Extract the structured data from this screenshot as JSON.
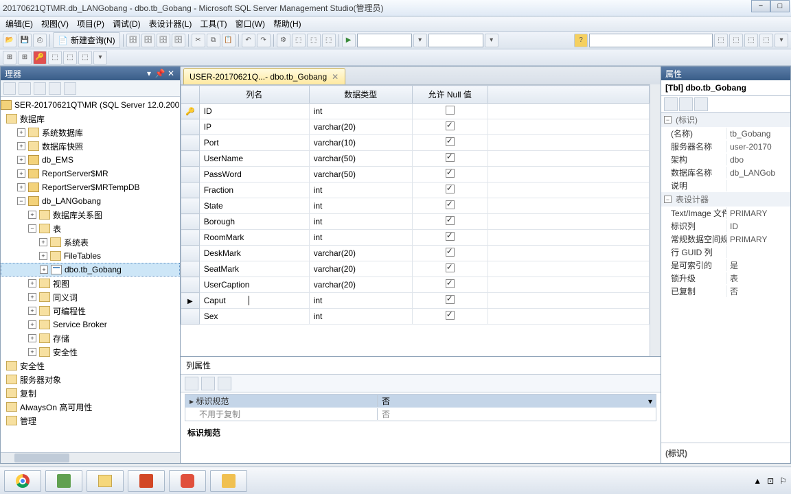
{
  "title": "20170621QT\\MR.db_LANGobang - dbo.tb_Gobang - Microsoft SQL Server Management Studio(管理员)",
  "menu": [
    "编辑(E)",
    "视图(V)",
    "项目(P)",
    "调试(D)",
    "表设计器(L)",
    "工具(T)",
    "窗口(W)",
    "帮助(H)"
  ],
  "toolbar_new": "新建查询(N)",
  "explorer": {
    "title": "理器",
    "server": "SER-20170621QT\\MR (SQL Server 12.0.200",
    "nodes": {
      "db": "数据库",
      "sysdb": "系统数据库",
      "dbsnap": "数据库快照",
      "ems": "db_EMS",
      "rs1": "ReportServer$MR",
      "rs2": "ReportServer$MRTempDB",
      "lan": "db_LANGobang",
      "diag": "数据库关系图",
      "tbl": "表",
      "systbl": "系统表",
      "ft": "FileTables",
      "gobang": "dbo.tb_Gobang",
      "view": "视图",
      "syn": "同义词",
      "prog": "可编程性",
      "sb": "Service Broker",
      "stor": "存储",
      "sec": "安全性",
      "sec2": "安全性",
      "so": "服务器对象",
      "rep": "复制",
      "ao": "AlwaysOn 高可用性",
      "mgmt": "管理"
    }
  },
  "tab": "USER-20170621Q...- dbo.tb_Gobang",
  "gridheaders": {
    "col": "列名",
    "type": "数据类型",
    "null": "允许 Null 值"
  },
  "columns": [
    {
      "name": "ID",
      "type": "int",
      "null": false,
      "key": true
    },
    {
      "name": "IP",
      "type": "varchar(20)",
      "null": true
    },
    {
      "name": "Port",
      "type": "varchar(10)",
      "null": true
    },
    {
      "name": "UserName",
      "type": "varchar(50)",
      "null": true
    },
    {
      "name": "PassWord",
      "type": "varchar(50)",
      "null": true
    },
    {
      "name": "Fraction",
      "type": "int",
      "null": true
    },
    {
      "name": "State",
      "type": "int",
      "null": true
    },
    {
      "name": "Borough",
      "type": "int",
      "null": true
    },
    {
      "name": "RoomMark",
      "type": "int",
      "null": true
    },
    {
      "name": "DeskMark",
      "type": "varchar(20)",
      "null": true
    },
    {
      "name": "SeatMark",
      "type": "varchar(20)",
      "null": true
    },
    {
      "name": "UserCaption",
      "type": "varchar(20)",
      "null": true
    },
    {
      "name": "Caput",
      "type": "int",
      "null": true,
      "cur": true
    },
    {
      "name": "Sex",
      "type": "int",
      "null": true
    }
  ],
  "colprop": {
    "title": "列属性",
    "id_spec": "标识规范",
    "id_val": "否",
    "norepl": "不用于复制",
    "norepl_val": "否",
    "footer": "标识规范"
  },
  "props": {
    "title": "属性",
    "obj": "[Tbl] dbo.tb_Gobang",
    "cat_id": "(标识)",
    "rows": [
      {
        "k": "(名称)",
        "v": "tb_Gobang"
      },
      {
        "k": "服务器名称",
        "v": "user-20170"
      },
      {
        "k": "架构",
        "v": "dbo"
      },
      {
        "k": "数据库名称",
        "v": "db_LANGob"
      },
      {
        "k": "说明",
        "v": ""
      }
    ],
    "cat_des": "表设计器",
    "rows2": [
      {
        "k": "Text/Image 文件",
        "v": "PRIMARY"
      },
      {
        "k": "标识列",
        "v": "ID"
      },
      {
        "k": "常规数据空间规范",
        "v": "PRIMARY"
      },
      {
        "k": "行 GUID 列",
        "v": ""
      },
      {
        "k": "是可索引的",
        "v": "是"
      },
      {
        "k": "锁升级",
        "v": "表"
      },
      {
        "k": "已复制",
        "v": "否"
      }
    ],
    "desc": "(标识)"
  }
}
